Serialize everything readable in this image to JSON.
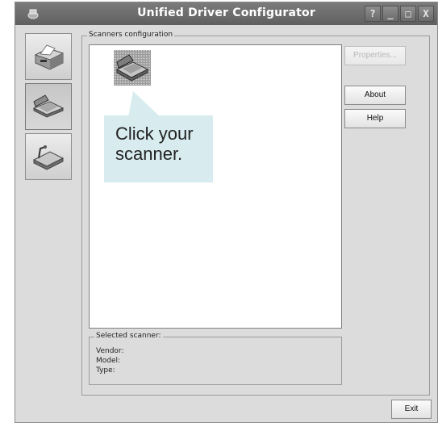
{
  "window": {
    "title": "Unified Driver Configurator",
    "controls": {
      "help": "?",
      "minimize": "_",
      "maximize": "□",
      "close": "X"
    }
  },
  "sidebar": {
    "items": [
      {
        "name": "printers",
        "icon": "printer-icon",
        "active": false
      },
      {
        "name": "scanners",
        "icon": "scanner-icon",
        "active": true
      },
      {
        "name": "ports",
        "icon": "port-icon",
        "active": false
      }
    ]
  },
  "scanners_config": {
    "legend": "Scanners configuration",
    "items": [
      {
        "icon": "scanner-icon",
        "selected": true
      }
    ]
  },
  "callout": {
    "text": "Click your\nscanner."
  },
  "selected_scanner": {
    "legend": "Selected scanner:",
    "vendor_label": "Vendor:",
    "model_label": "Model:",
    "type_label": "Type:"
  },
  "buttons": {
    "properties": "Properties...",
    "about": "About",
    "help": "Help",
    "exit": "Exit"
  },
  "colors": {
    "titlebar": "#6b6b6b",
    "window_bg": "#dcdcdc",
    "callout_bg": "#d8ecef"
  }
}
